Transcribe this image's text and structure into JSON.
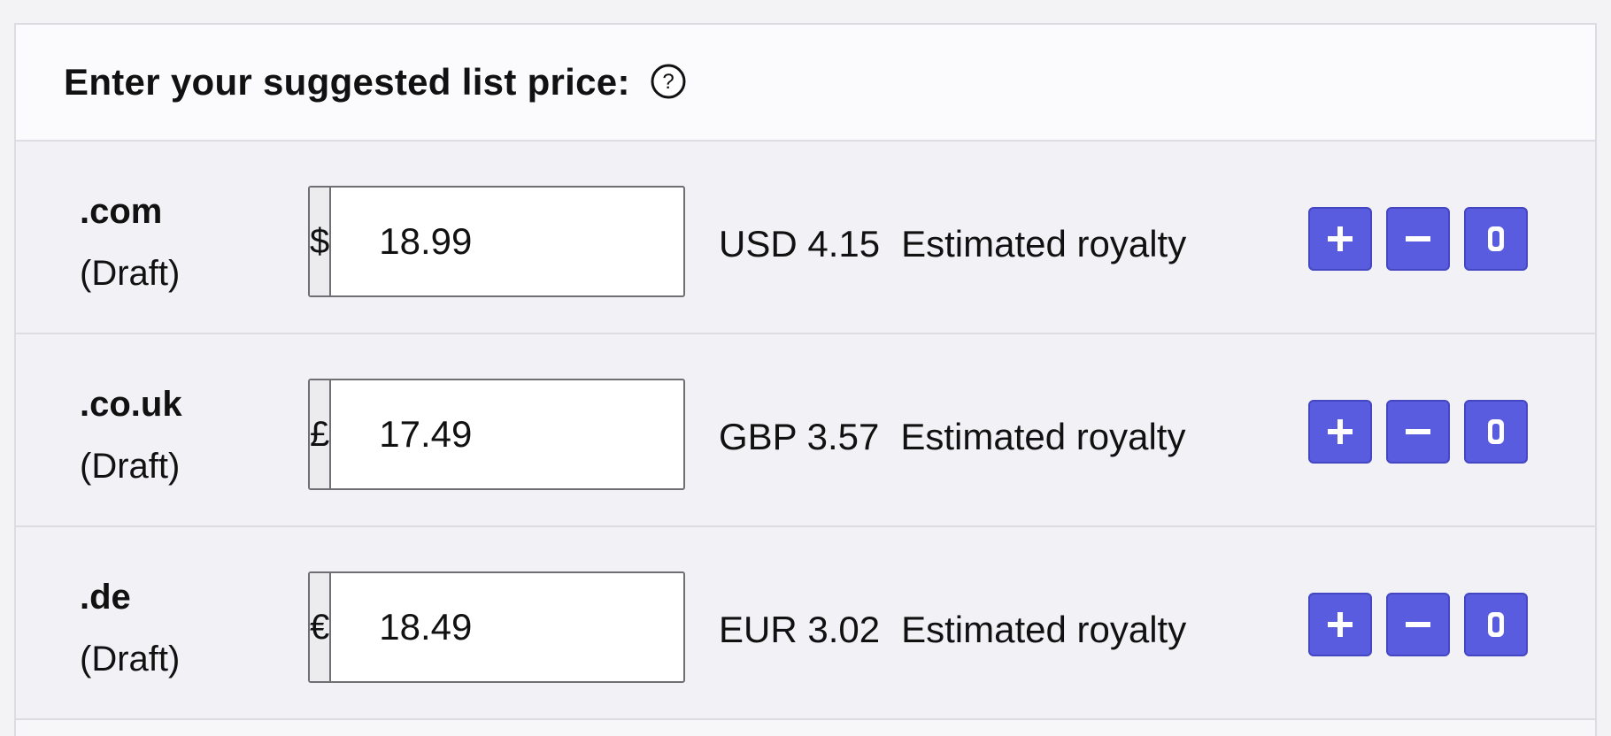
{
  "panel": {
    "title": "Enter your suggested list price:",
    "help_icon": "question-circle-icon"
  },
  "colors": {
    "accent": "#5a5ce0",
    "border": "#dcdce2",
    "row_background": "#f2f2f6"
  },
  "rows": [
    {
      "marketplace": ".com",
      "status": "(Draft)",
      "currency_symbol": "$",
      "price": "18.99",
      "royalty_amount": "USD 4.15",
      "royalty_label": "Estimated royalty"
    },
    {
      "marketplace": ".co.uk",
      "status": "(Draft)",
      "currency_symbol": "£",
      "price": "17.49",
      "royalty_amount": "GBP 3.57",
      "royalty_label": "Estimated royalty"
    },
    {
      "marketplace": ".de",
      "status": "(Draft)",
      "currency_symbol": "€",
      "price": "18.49",
      "royalty_amount": "EUR 3.02",
      "royalty_label": "Estimated royalty"
    }
  ],
  "row_actions": {
    "icons": [
      "plus-icon",
      "minus-icon",
      "zero-icon"
    ]
  }
}
